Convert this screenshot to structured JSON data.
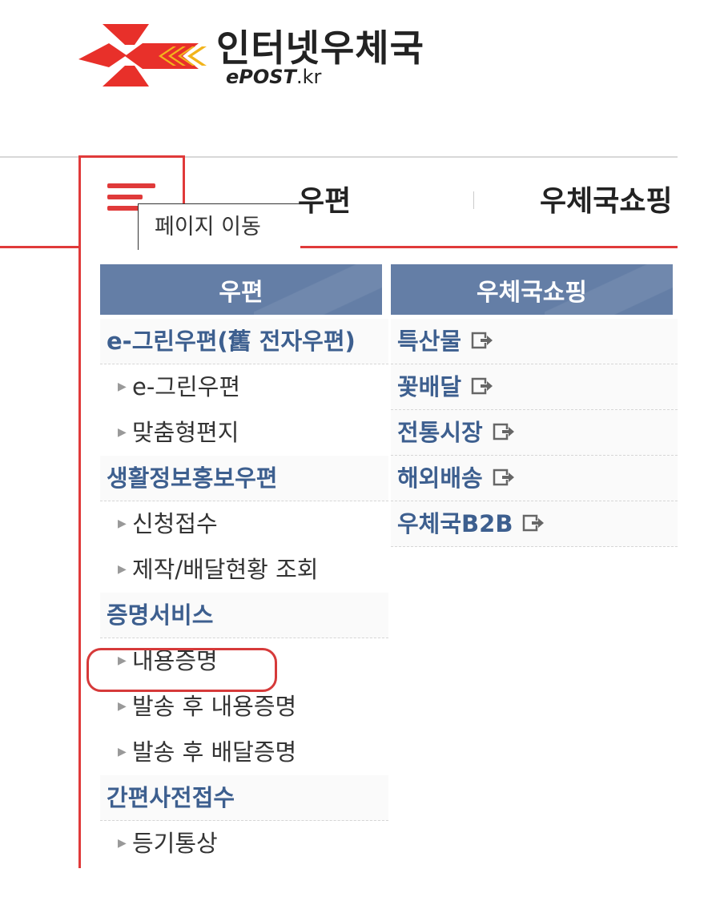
{
  "logo": {
    "title": "인터넷우체국",
    "subtitle_prefix": "e",
    "subtitle_main": "POST",
    "subtitle_suffix": ".kr"
  },
  "header": {
    "menu_tooltip": "페이지 이동",
    "nav_post": "우편",
    "nav_shop": "우체국쇼핑"
  },
  "post_column": {
    "header": "우편",
    "rows": [
      {
        "type": "category",
        "label": "e-그린우편(舊 전자우편)"
      },
      {
        "type": "item",
        "label": "e-그린우편"
      },
      {
        "type": "item",
        "label": "맞춤형편지"
      },
      {
        "type": "category",
        "label": "생활정보홍보우편"
      },
      {
        "type": "item",
        "label": "신청접수"
      },
      {
        "type": "item",
        "label": "제작/배달현황 조회"
      },
      {
        "type": "category",
        "label": "증명서비스"
      },
      {
        "type": "item",
        "label": "내용증명"
      },
      {
        "type": "item",
        "label": "발송 후 내용증명"
      },
      {
        "type": "item",
        "label": "발송 후 배달증명"
      },
      {
        "type": "category",
        "label": "간편사전접수"
      },
      {
        "type": "item",
        "label": "등기통상"
      }
    ]
  },
  "shop_column": {
    "header": "우체국쇼핑",
    "rows": [
      {
        "label": "특산물",
        "icon": "external-link-icon"
      },
      {
        "label": "꽃배달",
        "icon": "external-link-icon"
      },
      {
        "label": "전통시장",
        "icon": "external-link-icon"
      },
      {
        "label": "해외배송",
        "icon": "external-link-icon"
      },
      {
        "label": "우체국B2B",
        "icon": "external-link-icon"
      }
    ]
  },
  "colors": {
    "accent_red": "#e03a3a",
    "header_blue": "#647ea6",
    "category_blue": "#3d5f8f"
  },
  "highlight": {
    "target": "내용증명"
  }
}
